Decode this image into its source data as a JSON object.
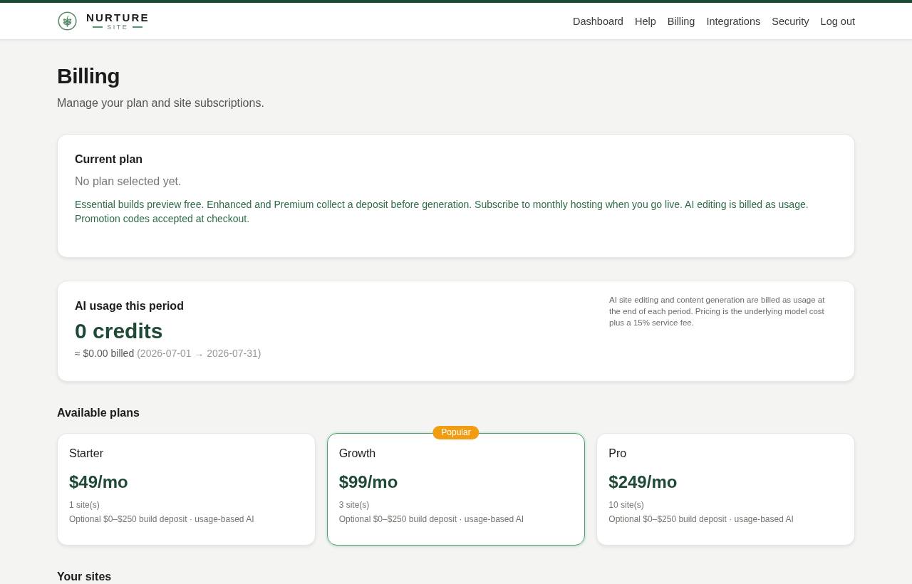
{
  "header": {
    "logo": {
      "name": "NURTURE",
      "tagline": "SITE"
    },
    "nav": [
      {
        "label": "Dashboard"
      },
      {
        "label": "Help"
      },
      {
        "label": "Billing"
      },
      {
        "label": "Integrations"
      },
      {
        "label": "Security"
      },
      {
        "label": "Log out"
      }
    ]
  },
  "page": {
    "title": "Billing",
    "subtitle": "Manage your plan and site subscriptions."
  },
  "current_plan": {
    "title": "Current plan",
    "status": "No plan selected yet.",
    "note": "Essential builds preview free. Enhanced and Premium collect a deposit before generation. Subscribe to monthly hosting when you go live. AI editing is billed as usage. Promotion codes accepted at checkout."
  },
  "usage": {
    "title": "AI usage this period",
    "credits": "0 credits",
    "billed": "≈ $0.00 billed",
    "period": "(2026-07-01 → 2026-07-31)",
    "note": "AI site editing and content generation are billed as usage at the end of each period. Pricing is the underlying model cost plus a 15% service fee."
  },
  "plans": {
    "title": "Available plans",
    "items": [
      {
        "name": "Starter",
        "price": "$49/mo",
        "sites": "1 site(s)",
        "details": "Optional $0–$250 build deposit · usage-based AI",
        "featured": false
      },
      {
        "name": "Growth",
        "price": "$99/mo",
        "sites": "3 site(s)",
        "details": "Optional $0–$250 build deposit · usage-based AI",
        "featured": true,
        "badge": "Popular"
      },
      {
        "name": "Pro",
        "price": "$249/mo",
        "sites": "10 site(s)",
        "details": "Optional $0–$250 build deposit · usage-based AI",
        "featured": false
      }
    ]
  },
  "sites": {
    "title": "Your sites"
  }
}
